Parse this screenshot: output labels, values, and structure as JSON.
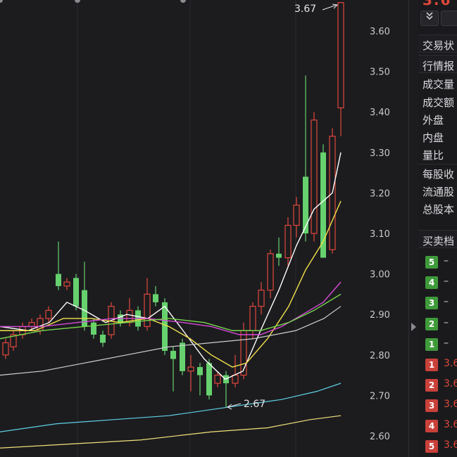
{
  "chart": {
    "y_axis_ticks": [
      "3.60",
      "3.50",
      "3.40",
      "3.30",
      "3.20",
      "3.10",
      "3.00",
      "2.90",
      "2.80",
      "2.70",
      "2.60"
    ],
    "high_marker": "3.67",
    "low_marker": "2.67",
    "colors": {
      "up": "#e0473b",
      "down": "#66d16e",
      "ma5": "#ffffff",
      "ma10": "#f1e04b",
      "ma20": "#d64bd8",
      "ma30": "#77d74c",
      "ma60": "#cfcfcf",
      "ma120": "#5fd0e6",
      "ma250": "#f3e27a"
    }
  },
  "side_panel": {
    "price_partial": "3.6",
    "toolbar_icon": "double-chevron-down-icon",
    "section_trade_status": "交易状",
    "section_quote": "行情报",
    "rows": [
      "成交量",
      "成交额",
      "外盘",
      "内盘",
      "量比"
    ],
    "rows2": [
      "每股收",
      "流通股",
      "总股本"
    ],
    "section_order_book": "买卖档",
    "buy_levels": [
      {
        "level": "5",
        "value": "–"
      },
      {
        "level": "4",
        "value": "–"
      },
      {
        "level": "3",
        "value": "–"
      },
      {
        "level": "2",
        "value": "–"
      },
      {
        "level": "1",
        "value": "–"
      }
    ],
    "sell_levels": [
      {
        "level": "1",
        "value": "3.6"
      },
      {
        "level": "2",
        "value": "3.6"
      },
      {
        "level": "3",
        "value": "3.6"
      },
      {
        "level": "4",
        "value": "3.6"
      },
      {
        "level": "5",
        "value": "3.6"
      }
    ]
  }
}
